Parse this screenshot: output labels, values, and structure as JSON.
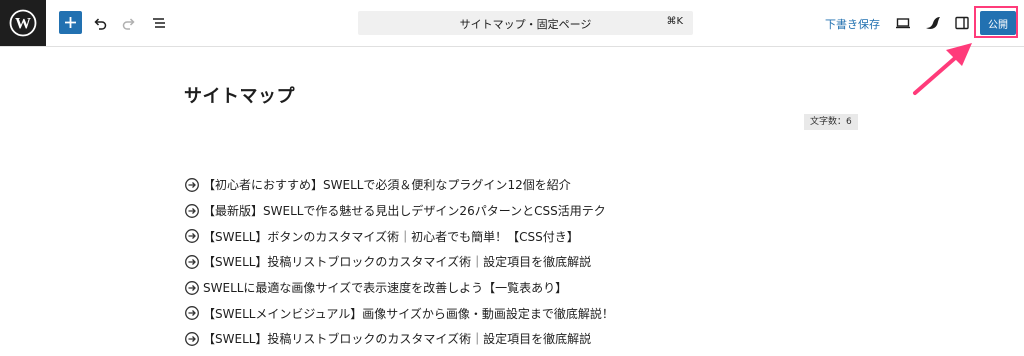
{
  "header": {
    "command_title": "サイトマップ・固定ページ",
    "command_shortcut": "⌘K",
    "save_draft_label": "下書き保存",
    "publish_label": "公開"
  },
  "editor": {
    "page_title": "サイトマップ",
    "char_count": "文字数：6"
  },
  "post_list": [
    "【初心者におすすめ】SWELLで必須＆便利なプラグイン12個を紹介",
    "【最新版】SWELLで作る魅せる見出しデザイン26パターンとCSS活用テク",
    "【SWELL】ボタンのカスタマイズ術｜初心者でも簡単！【CSS付き】",
    "【SWELL】投稿リストブロックのカスタマイズ術｜設定項目を徹底解説",
    "SWELLに最適な画像サイズで表示速度を改善しよう【一覧表あり】",
    "【SWELLメインビジュアル】画像サイズから画像・動画設定まで徹底解説！",
    "【SWELL】投稿リストブロックのカスタマイズ術｜設定項目を徹底解説"
  ],
  "colors": {
    "accent": "#2271b1",
    "annotation": "#ff3b7a",
    "dark": "#1e1e1e"
  },
  "icons": [
    "wordpress-logo-icon",
    "plus-icon",
    "undo-icon",
    "redo-icon",
    "list-view-icon",
    "desktop-preview-icon",
    "swell-logo-icon",
    "sidebar-toggle-icon",
    "circle-arrow-right-icon"
  ]
}
